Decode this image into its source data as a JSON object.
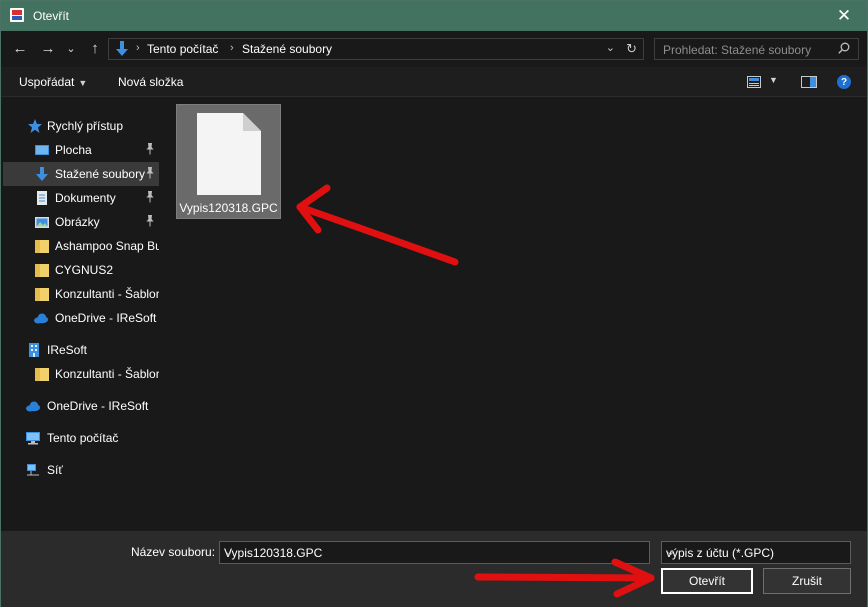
{
  "window": {
    "title": "Otevřít",
    "close_glyph": "✕"
  },
  "nav": {
    "back_glyph": "←",
    "forward_glyph": "→",
    "recent_glyph": "⌄",
    "up_glyph": "↑"
  },
  "address": {
    "sep": "›",
    "crumbs": [
      "Tento počítač",
      "Stažené soubory"
    ],
    "chevron": "⌄",
    "refresh": "↻"
  },
  "search": {
    "placeholder": "Prohledat: Stažené soubory"
  },
  "toolbar": {
    "organize": "Uspořádat",
    "new_folder": "Nová složka",
    "help": "?"
  },
  "sidebar": {
    "items": [
      {
        "label": "Rychlý přístup",
        "icon": "star-icon"
      },
      {
        "label": "Plocha",
        "icon": "desktop-icon",
        "pinned": true
      },
      {
        "label": "Stažené soubory",
        "icon": "download-icon",
        "pinned": true,
        "selected": true
      },
      {
        "label": "Dokumenty",
        "icon": "document-icon",
        "pinned": true
      },
      {
        "label": "Obrázky",
        "icon": "pictures-icon",
        "pinned": true
      },
      {
        "label": "Ashampoo Snap Bu",
        "icon": "folder-icon"
      },
      {
        "label": "CYGNUS2",
        "icon": "folder-icon"
      },
      {
        "label": "Konzultanti - Šablor",
        "icon": "folder-icon"
      },
      {
        "label": "OneDrive - IReSoft",
        "icon": "onedrive-icon"
      },
      {
        "label": "IReSoft",
        "icon": "building-icon"
      },
      {
        "label": "Konzultanti - Šablor",
        "icon": "folder-icon"
      },
      {
        "label": "OneDrive - IReSoft",
        "icon": "onedrive-icon"
      },
      {
        "label": "Tento počítač",
        "icon": "computer-icon"
      },
      {
        "label": "Síť",
        "icon": "network-icon"
      }
    ]
  },
  "files": [
    {
      "name": "Vypis120318.GPC",
      "icon": "file-icon",
      "selected": true
    }
  ],
  "footer": {
    "filename_label": "Název souboru:",
    "filename_value": "Vypis120318.GPC",
    "filetype_value": "výpis z účtu (*.GPC)",
    "open_button": "Otevřít",
    "cancel_button": "Zrušit",
    "dropdown_glyph": "⌄"
  },
  "colors": {
    "titlebar": "#447260",
    "accent_blue": "#1f6fcf",
    "annotation_red": "#e01010"
  }
}
